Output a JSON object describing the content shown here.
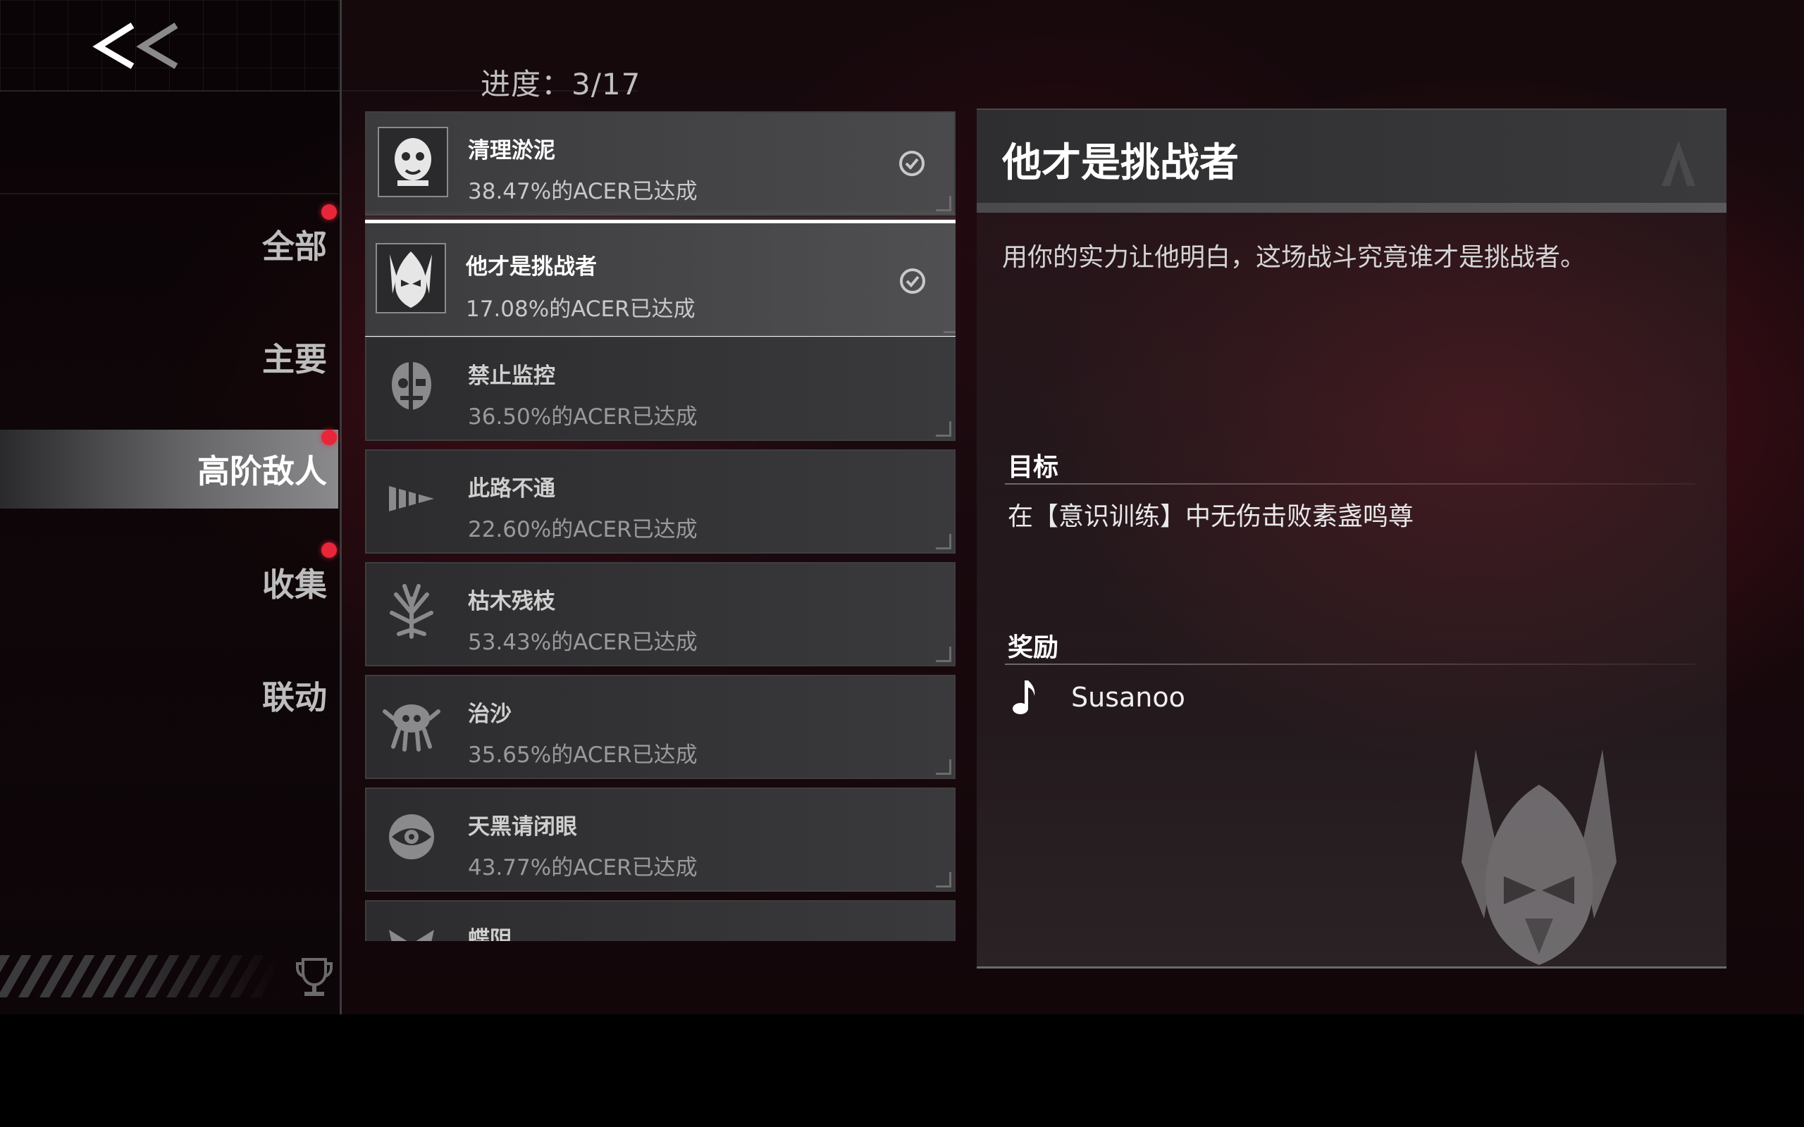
{
  "nav": {
    "back_icon": "double-chevron-left-icon"
  },
  "categories": [
    {
      "label": "全部",
      "has_badge": true,
      "active": false
    },
    {
      "label": "主要",
      "has_badge": false,
      "active": false
    },
    {
      "label": "高阶敌人",
      "has_badge": true,
      "active": true
    },
    {
      "label": "收集",
      "has_badge": true,
      "active": false
    },
    {
      "label": "联动",
      "has_badge": false,
      "active": false
    }
  ],
  "progress": {
    "label": "进度：3/17",
    "completed": 3,
    "total": 17
  },
  "achievements": [
    {
      "name": "清理淤泥",
      "percent": "38.47%的ACER已达成",
      "completed": true,
      "icon": "masked-skull-icon"
    },
    {
      "name": "他才是挑战者",
      "percent": "17.08%的ACER已达成",
      "completed": true,
      "selected": true,
      "icon": "horned-mask-icon"
    },
    {
      "name": "禁止监控",
      "percent": "36.50%的ACER已达成",
      "completed": false,
      "icon": "cyborg-face-icon"
    },
    {
      "name": "此路不通",
      "percent": "22.60%的ACER已达成",
      "completed": false,
      "icon": "drill-icon"
    },
    {
      "name": "枯木残枝",
      "percent": "53.43%的ACER已达成",
      "completed": false,
      "icon": "thorny-branch-icon"
    },
    {
      "name": "治沙",
      "percent": "35.65%的ACER已达成",
      "completed": false,
      "icon": "sand-creature-icon"
    },
    {
      "name": "天黑请闭眼",
      "percent": "43.77%的ACER已达成",
      "completed": false,
      "icon": "eye-icon"
    },
    {
      "name": "蝶阴",
      "percent": "",
      "completed": false,
      "icon": "butterfly-icon"
    }
  ],
  "detail": {
    "title": "他才是挑战者",
    "description": "用你的实力让他明白，这场战斗究竟谁才是挑战者。",
    "objective_heading": "目标",
    "objective": "在【意识训练】中无伤击败素盏鸣尊",
    "reward_heading": "奖励",
    "reward_name": "Susanoo",
    "reward_icon": "music-note-icon",
    "emblem_icon": "horned-mask-icon"
  },
  "colors": {
    "badge_red": "#e8263a",
    "selected_border": "#ffffff",
    "background_red": "#1b0a0f"
  }
}
